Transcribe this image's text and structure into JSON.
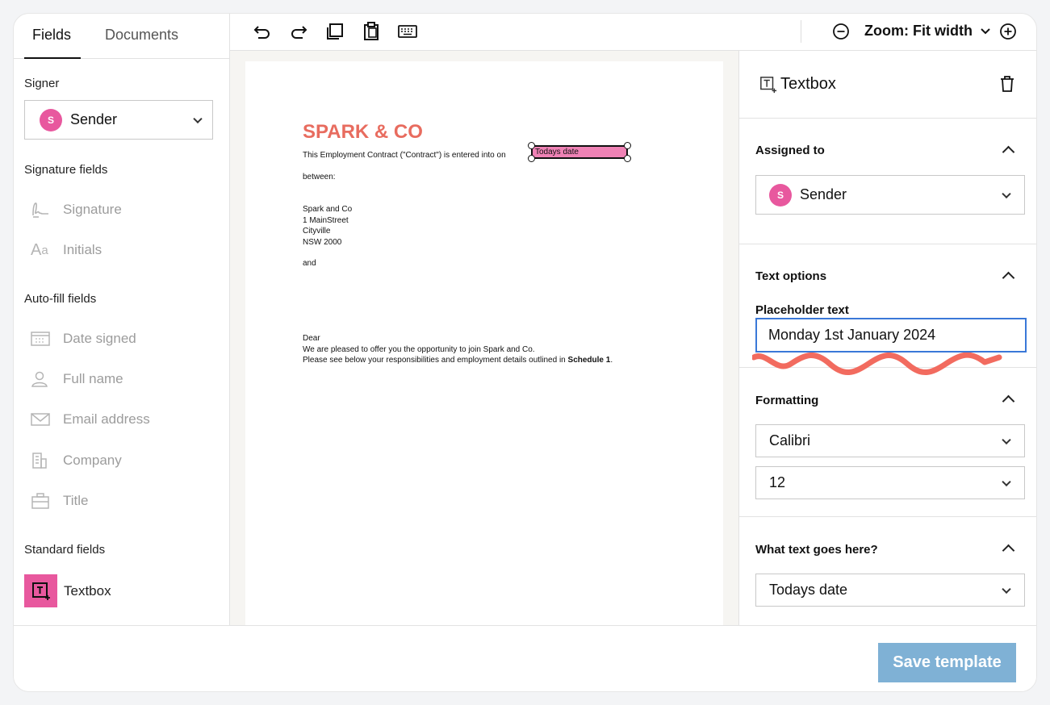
{
  "tabs": {
    "fields": "Fields",
    "documents": "Documents"
  },
  "sidebar": {
    "signer_label": "Signer",
    "signer": {
      "initial": "S",
      "name": "Sender"
    },
    "signature_fields_label": "Signature fields",
    "signature_fields": [
      {
        "label": "Signature",
        "icon": "signature-icon"
      },
      {
        "label": "Initials",
        "icon": "initials-icon"
      }
    ],
    "autofill_label": "Auto-fill fields",
    "autofill_fields": [
      {
        "label": "Date signed",
        "icon": "calendar-icon"
      },
      {
        "label": "Full name",
        "icon": "person-icon"
      },
      {
        "label": "Email address",
        "icon": "envelope-icon"
      },
      {
        "label": "Company",
        "icon": "building-icon"
      },
      {
        "label": "Title",
        "icon": "briefcase-icon"
      }
    ],
    "standard_label": "Standard fields",
    "standard_fields": [
      {
        "label": "Textbox",
        "icon": "textbox-icon"
      }
    ]
  },
  "toolbar": {
    "zoom_label": "Zoom: Fit width"
  },
  "document": {
    "title": "SPARK & CO",
    "intro": "This Employment Contract (\"Contract\") is entered into on",
    "date_field": "Todays date",
    "between": "between:",
    "address": [
      "Spark and Co",
      "1 MainStreet",
      "Cityville",
      "NSW 2000"
    ],
    "and": "and",
    "dear": "Dear",
    "line1": "We are pleased to offer you the opportunity to join Spark and Co.",
    "line2_prefix": "Please see below your responsibilities and employment details outlined in ",
    "line2_bold": "Schedule 1",
    "line2_suffix": "."
  },
  "panel": {
    "title": "Textbox",
    "assigned_to_label": "Assigned to",
    "assigned": {
      "initial": "S",
      "name": "Sender"
    },
    "text_options_label": "Text options",
    "placeholder_label": "Placeholder text",
    "placeholder_value": "Monday 1st January 2024",
    "formatting_label": "Formatting",
    "font_value": "Calibri",
    "size_value": "12",
    "what_text_label": "What text goes here?",
    "what_text_value": "Todays date"
  },
  "footer": {
    "save_label": "Save template"
  },
  "colors": {
    "accent_pink": "#e8589e",
    "save_blue": "#7fb1d5",
    "title_coral": "#e86c5f",
    "focus_blue": "#3a78d8",
    "squiggle": "#f26b5f"
  }
}
